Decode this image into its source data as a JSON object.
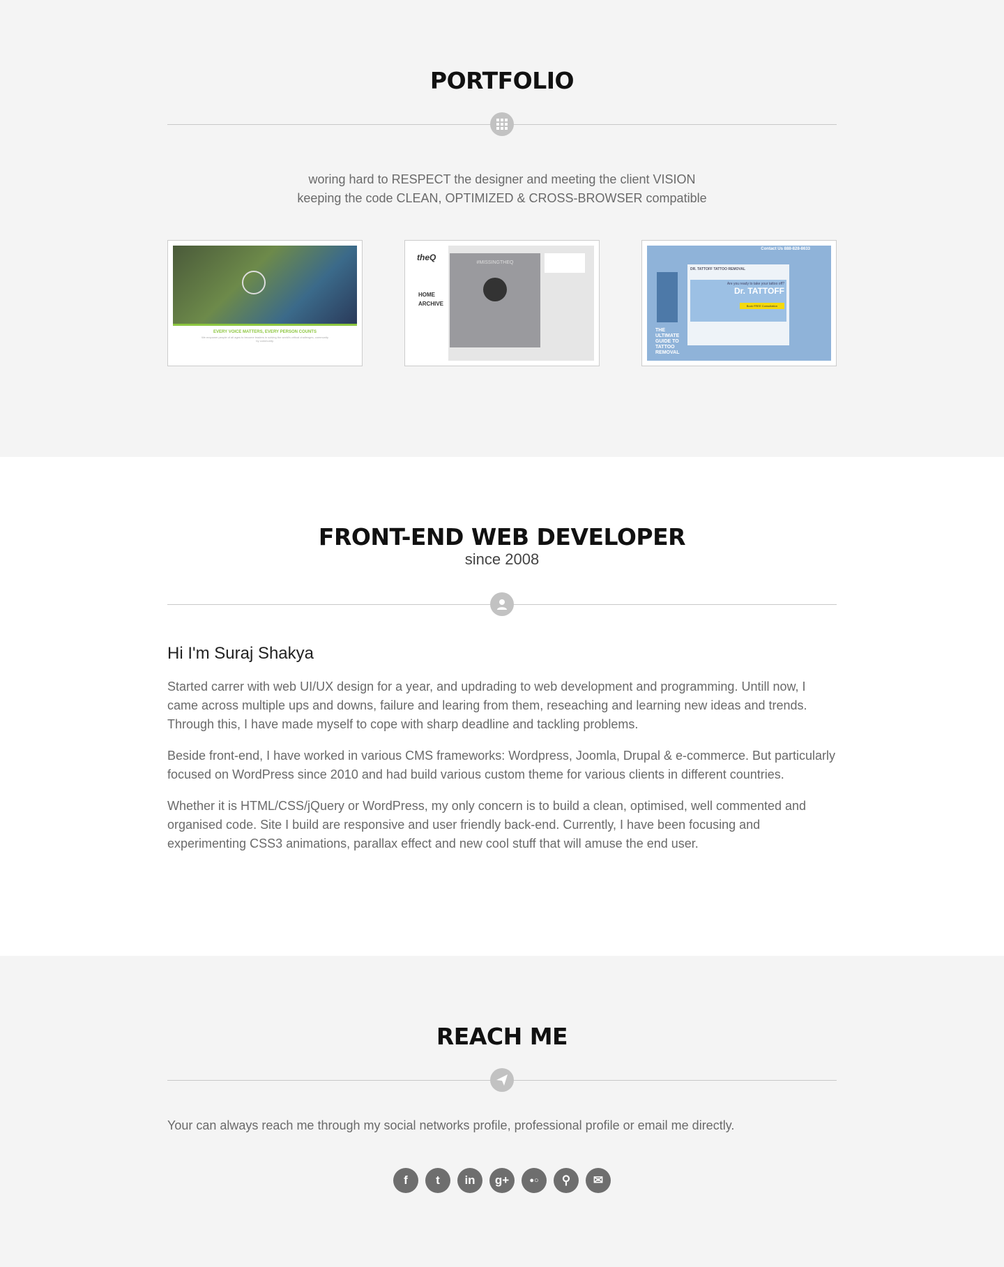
{
  "portfolio": {
    "title": "PORTFOLIO",
    "icon": "grid-icon",
    "tagline": [
      "woring hard to RESPECT the designer and meeting the client VISION",
      "keeping the code CLEAN, OPTIMIZED & CROSS-BROWSER compatible"
    ],
    "items": [
      {
        "caption": "EVERY VOICE MATTERS, EVERY PERSON COUNTS",
        "sub": "We empower people of all ages to become leaders in solving the world's critical challenges, community by community."
      },
      {
        "brand": "theQ",
        "headline": "#MISSINGTHEQ",
        "nav": [
          "HOME",
          "ARCHIVE"
        ]
      },
      {
        "contact": "Contact Us 888-828-8633",
        "title": "DR. TATTOFF TATTOO REMOVAL",
        "question": "Are you ready to take your tattoo off?",
        "brand": "Dr. TATTOFF",
        "cta": "Book FREE Consultation",
        "guide": "THE ULTIMATE GUIDE TO TATTOO REMOVAL"
      }
    ]
  },
  "about": {
    "title": "FRONT-END WEB DEVELOPER",
    "subtitle": "since 2008",
    "icon": "user-icon",
    "greeting": "Hi I'm Suraj Shakya",
    "paragraphs": [
      "Started carrer with web UI/UX design for a year, and updrading to web development and programming. Untill now, I came across multiple ups and downs, failure and learing from them, reseaching and learning new ideas and trends. Through this, I have made myself to cope with sharp deadline and tackling problems.",
      "Beside front-end, I have worked in various CMS frameworks: Wordpress, Joomla, Drupal & e-commerce. But particularly focused on WordPress since 2010 and had build various custom theme for various clients in different countries.",
      "Whether it is HTML/CSS/jQuery or WordPress, my only concern is to build a clean, optimised, well commented and organised code. Site I build are responsive and user friendly back-end. Currently, I have been focusing and experimenting CSS3 animations, parallax effect and new cool stuff that will amuse the end user."
    ]
  },
  "reach": {
    "title": "REACH ME",
    "icon": "paper-plane-icon",
    "text": "Your can always reach me through my social networks profile, professional profile or email me directly.",
    "social": [
      {
        "icon": "facebook-icon",
        "glyph": "f"
      },
      {
        "icon": "twitter-icon",
        "glyph": "t"
      },
      {
        "icon": "linkedin-icon",
        "glyph": "in"
      },
      {
        "icon": "google-plus-icon",
        "glyph": "g+"
      },
      {
        "icon": "flickr-icon",
        "glyph": "●○"
      },
      {
        "icon": "profile-icon",
        "glyph": "⚲"
      },
      {
        "icon": "email-icon",
        "glyph": "✉"
      }
    ]
  }
}
